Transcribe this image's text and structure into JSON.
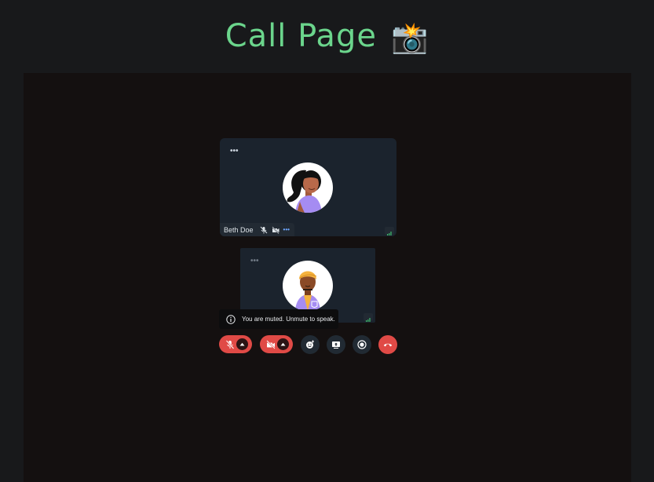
{
  "page": {
    "title": "Call Page",
    "title_emoji": "📸",
    "title_color": "#6bd58c"
  },
  "participants": [
    {
      "name": "Beth Doe",
      "mic": "muted",
      "camera": "off",
      "role": "remote"
    },
    {
      "role": "self"
    }
  ],
  "toast": {
    "message": "You are muted. Unmute to speak.",
    "icon": "info-icon"
  },
  "controls": [
    {
      "id": "microphone",
      "icon": "mic-off-icon",
      "state": "off",
      "has_menu": true
    },
    {
      "id": "camera",
      "icon": "camera-off-icon",
      "state": "off",
      "has_menu": true
    },
    {
      "id": "reactions",
      "icon": "emoji-add-icon"
    },
    {
      "id": "screen-share",
      "icon": "screen-share-icon"
    },
    {
      "id": "record",
      "icon": "record-icon"
    },
    {
      "id": "end-call",
      "icon": "hang-up-icon",
      "color": "#e04a46"
    }
  ],
  "colors": {
    "danger": "#e04a46",
    "tile_bg": "#1b232d",
    "stage_bg": "#141010",
    "page_bg": "#18191b"
  }
}
